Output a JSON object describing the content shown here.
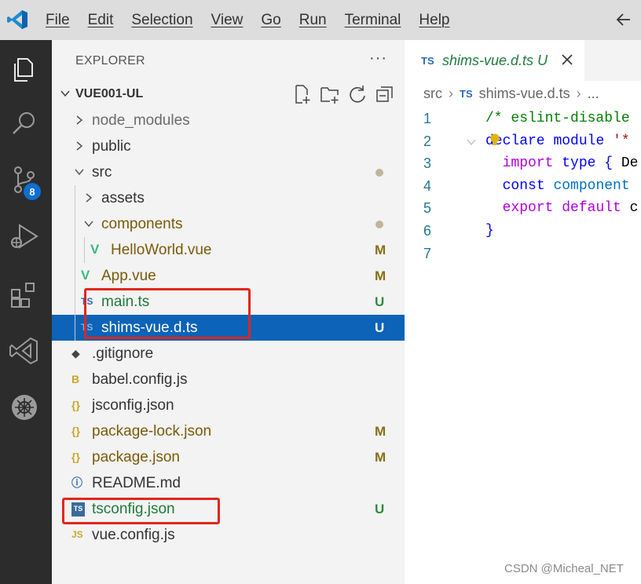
{
  "menu": [
    "File",
    "Edit",
    "Selection",
    "View",
    "Go",
    "Run",
    "Terminal",
    "Help"
  ],
  "activity": {
    "scm_badge": "8"
  },
  "explorer": {
    "title": "EXPLORER",
    "more": "···",
    "workspace": "VUE001-UL",
    "tree": [
      {
        "label": "node_modules",
        "depth": 0,
        "kind": "folder-closed",
        "color": "#6b6b6b",
        "status": ""
      },
      {
        "label": "public",
        "depth": 0,
        "kind": "folder-closed",
        "color": "#333333",
        "status": ""
      },
      {
        "label": "src",
        "depth": 0,
        "kind": "folder-open",
        "color": "#333333",
        "status": "dot"
      },
      {
        "label": "assets",
        "depth": 1,
        "kind": "folder-closed",
        "color": "#333333",
        "status": ""
      },
      {
        "label": "components",
        "depth": 1,
        "kind": "folder-open",
        "color": "#7a5a0a",
        "status": "dot"
      },
      {
        "label": "HelloWorld.vue",
        "depth": 2,
        "kind": "vue",
        "color": "#7a5a0a",
        "status": "M"
      },
      {
        "label": "App.vue",
        "depth": 1,
        "kind": "vue",
        "color": "#7a5a0a",
        "status": "M"
      },
      {
        "label": "main.ts",
        "depth": 1,
        "kind": "ts",
        "color": "#1e7b3c",
        "status": "U"
      },
      {
        "label": "shims-vue.d.ts",
        "depth": 1,
        "kind": "ts",
        "color": "#ffffff",
        "status": "U",
        "selected": true
      },
      {
        "label": ".gitignore",
        "depth": 0,
        "kind": "git",
        "color": "#333333",
        "status": ""
      },
      {
        "label": "babel.config.js",
        "depth": 0,
        "kind": "babel",
        "color": "#333333",
        "status": ""
      },
      {
        "label": "jsconfig.json",
        "depth": 0,
        "kind": "json",
        "color": "#333333",
        "status": ""
      },
      {
        "label": "package-lock.json",
        "depth": 0,
        "kind": "json",
        "color": "#7a5a0a",
        "status": "M"
      },
      {
        "label": "package.json",
        "depth": 0,
        "kind": "json",
        "color": "#7a5a0a",
        "status": "M"
      },
      {
        "label": "README.md",
        "depth": 0,
        "kind": "info",
        "color": "#333333",
        "status": ""
      },
      {
        "label": "tsconfig.json",
        "depth": 0,
        "kind": "tsconfig",
        "color": "#1e7b3c",
        "status": "U"
      },
      {
        "label": "vue.config.js",
        "depth": 0,
        "kind": "js",
        "color": "#333333",
        "status": ""
      }
    ]
  },
  "editor": {
    "tab": {
      "badge": "TS",
      "name": "shims-vue.d.ts",
      "status": "U"
    },
    "breadcrumb": {
      "folder": "src",
      "badge": "TS",
      "file": "shims-vue.d.ts",
      "more": "..."
    },
    "lines": [
      {
        "n": "1",
        "tokens": [
          [
            "k-comment",
            "/* eslint-disable"
          ]
        ]
      },
      {
        "n": "2",
        "tokens": [
          [
            "k-kw",
            "declare"
          ],
          [
            "k-txt",
            " "
          ],
          [
            "k-kw",
            "module"
          ],
          [
            "k-txt",
            " "
          ],
          [
            "k-str",
            "'*"
          ]
        ]
      },
      {
        "n": "3",
        "tokens": [
          [
            "k-txt",
            "  "
          ],
          [
            "k-ctrl",
            "import"
          ],
          [
            "k-txt",
            " "
          ],
          [
            "k-kw",
            "type"
          ],
          [
            "k-txt",
            " "
          ],
          [
            "k-kw",
            "{"
          ],
          [
            "k-txt",
            " De"
          ]
        ]
      },
      {
        "n": "4",
        "tokens": [
          [
            "k-txt",
            "  "
          ],
          [
            "k-kw",
            "const"
          ],
          [
            "k-txt",
            " "
          ],
          [
            "k-var",
            "component"
          ]
        ]
      },
      {
        "n": "5",
        "tokens": [
          [
            "k-txt",
            "  "
          ],
          [
            "k-ctrl",
            "export"
          ],
          [
            "k-txt",
            " "
          ],
          [
            "k-ctrl",
            "default"
          ],
          [
            "k-txt",
            " c"
          ]
        ]
      },
      {
        "n": "6",
        "tokens": [
          [
            "k-kw",
            "}"
          ]
        ]
      },
      {
        "n": "7",
        "tokens": []
      }
    ]
  },
  "watermark": "CSDN @Micheal_NET"
}
